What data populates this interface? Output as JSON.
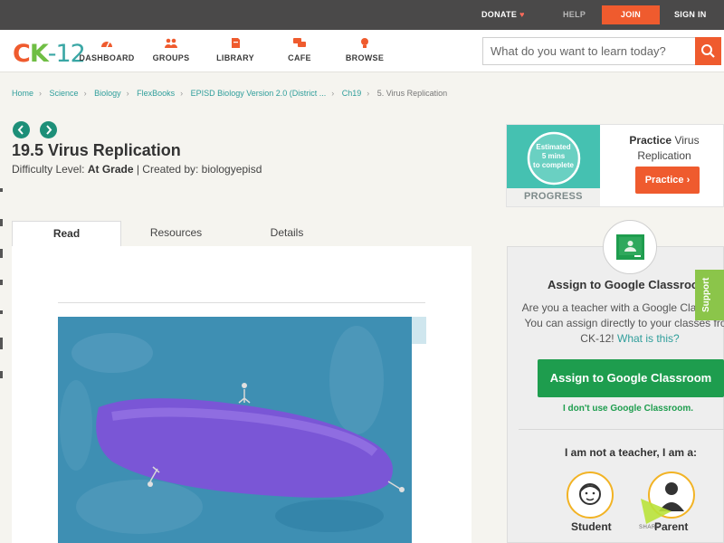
{
  "topbar": {
    "donate": "DONATE",
    "help": "HELP",
    "join": "JOIN",
    "signin": "SIGN IN"
  },
  "header": {
    "logo": {
      "c": "C",
      "k": "K",
      "n": "-12"
    },
    "nav": [
      {
        "label": "DASHBOARD",
        "icon": "dashboard-icon"
      },
      {
        "label": "GROUPS",
        "icon": "groups-icon"
      },
      {
        "label": "LIBRARY",
        "icon": "library-icon"
      },
      {
        "label": "CAFE",
        "icon": "cafe-icon"
      },
      {
        "label": "BROWSE",
        "icon": "browse-icon"
      }
    ],
    "search": {
      "placeholder": "What do you want to learn today?"
    }
  },
  "breadcrumb": {
    "items": [
      "Home",
      "Science",
      "Biology",
      "FlexBooks",
      "EPISD Biology Version 2.0 (District ...",
      "Ch19"
    ],
    "current": "5. Virus Replication"
  },
  "article": {
    "title": "19.5 Virus Replication",
    "difficulty_label": "Difficulty Level:",
    "difficulty": "At Grade",
    "created_by": "| Created by: biologyepisd"
  },
  "tabs": [
    {
      "label": "Read",
      "active": true
    },
    {
      "label": "Resources",
      "active": false
    },
    {
      "label": "Details",
      "active": false
    }
  ],
  "practice": {
    "estimated": "Estimated",
    "mins": "5 mins",
    "complete": "to complete",
    "progress": "PROGRESS",
    "title_bold": "Practice",
    "title_rest": "Virus Replication",
    "button": "Practice"
  },
  "assign": {
    "heading": "Assign to Google Classroom",
    "desc": "Are you a teacher with a Google Classroom? You can assign directly to your classes from CK-12!",
    "what_link": "What is this?",
    "button": "Assign to Google Classroom",
    "dont_use": "I don't use Google Classroom.",
    "not_teacher": "I am not a teacher, I am a:",
    "roles": [
      "Student",
      "Parent"
    ]
  },
  "support": "Support",
  "share": "SHARE",
  "colors": {
    "brand_orange": "#ef5b2e",
    "brand_teal": "#2f9e9b",
    "google_green": "#1e9d4e",
    "support_green": "#8bc54a"
  }
}
